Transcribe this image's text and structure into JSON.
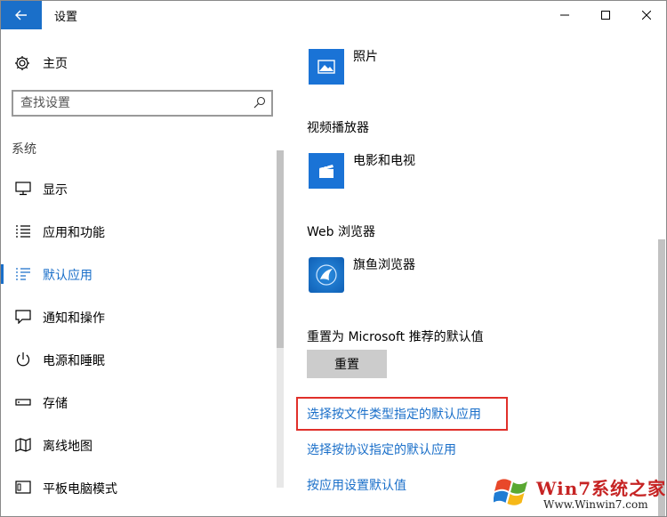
{
  "window": {
    "title": "设置"
  },
  "nav": {
    "home_label": "主页",
    "search_placeholder": "查找设置",
    "group_label": "系统",
    "items": [
      {
        "label": "显示",
        "icon": "monitor-icon"
      },
      {
        "label": "应用和功能",
        "icon": "list-icon"
      },
      {
        "label": "默认应用",
        "icon": "default-apps-icon",
        "selected": true
      },
      {
        "label": "通知和操作",
        "icon": "message-icon"
      },
      {
        "label": "电源和睡眠",
        "icon": "power-icon"
      },
      {
        "label": "存储",
        "icon": "storage-icon"
      },
      {
        "label": "离线地图",
        "icon": "map-icon"
      },
      {
        "label": "平板电脑模式",
        "icon": "tablet-icon"
      }
    ]
  },
  "content": {
    "photo_app": "照片",
    "video_title": "视频播放器",
    "video_app": "电影和电视",
    "browser_title": "Web 浏览器",
    "browser_app": "旗鱼浏览器",
    "reset_text": "重置为 Microsoft 推荐的默认值",
    "reset_button": "重置",
    "link_filetype": "选择按文件类型指定的默认应用",
    "link_protocol": "选择按协议指定的默认应用",
    "link_app_defaults": "按应用设置默认值"
  },
  "watermark": {
    "brand": "Win7系统之家",
    "url": "Www.Winwin7.com"
  },
  "colors": {
    "accent": "#1a6fc9",
    "tile": "#1a73d6",
    "highlight": "#e0302a"
  }
}
